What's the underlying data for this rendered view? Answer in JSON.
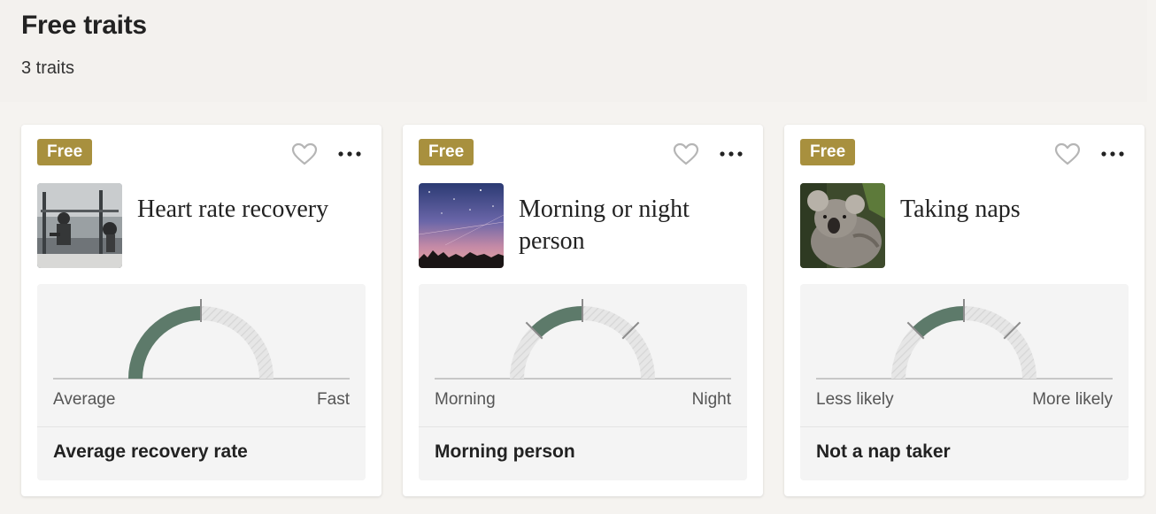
{
  "header": {
    "title": "Free traits",
    "count_label": "3 traits"
  },
  "colors": {
    "badge": "#a8903e",
    "gauge_fill": "#5d7a6a",
    "gauge_track": "#e6e6e6"
  },
  "cards": [
    {
      "badge": "Free",
      "title": "Heart rate recovery",
      "left_label": "Average",
      "right_label": "Fast",
      "result": "Average recovery rate",
      "gauge": {
        "fill_start": 0.0,
        "fill_end": 0.5,
        "ticks": [
          0.5
        ]
      }
    },
    {
      "badge": "Free",
      "title": "Morning or night person",
      "left_label": "Morning",
      "right_label": "Night",
      "result": "Morning person",
      "gauge": {
        "fill_start": 0.25,
        "fill_end": 0.5,
        "ticks": [
          0.25,
          0.5,
          0.75
        ]
      }
    },
    {
      "badge": "Free",
      "title": "Taking naps",
      "left_label": "Less likely",
      "right_label": "More likely",
      "result": "Not a nap taker",
      "gauge": {
        "fill_start": 0.25,
        "fill_end": 0.5,
        "ticks": [
          0.25,
          0.5,
          0.75
        ]
      }
    }
  ]
}
